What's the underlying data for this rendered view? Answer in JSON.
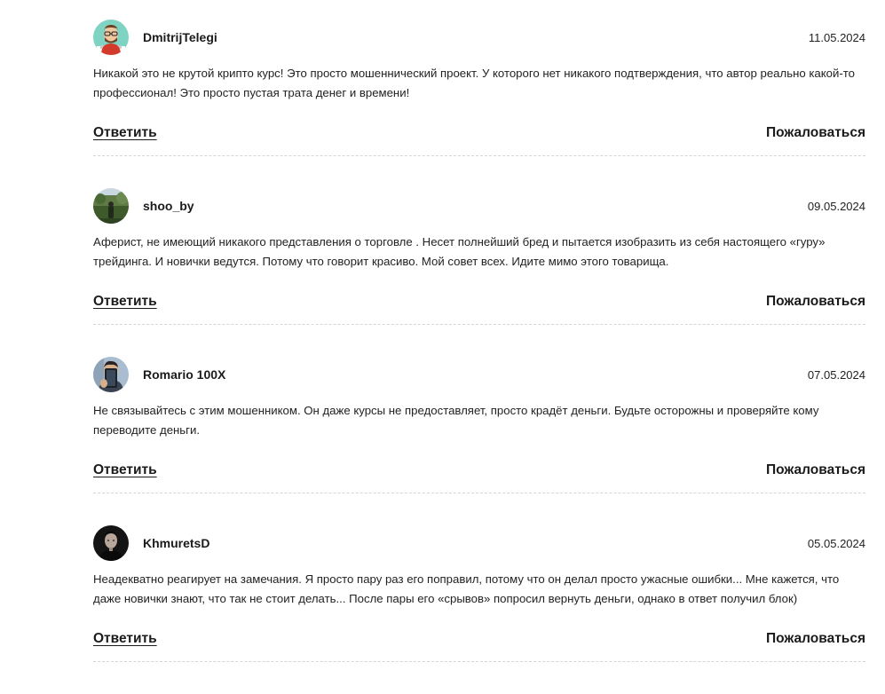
{
  "comments": [
    {
      "username": "DmitrijTelegi",
      "date": "11.05.2024",
      "text": "Никакой это не крутой крипто курс! Это просто мошеннический проект. У которого нет никакого подтверждения, что автор реально какой-то профессионал! Это просто пустая трата денег и времени!",
      "avatar_icon": "cartoon-avatar"
    },
    {
      "username": "shoo_by",
      "date": "09.05.2024",
      "text": "Аферист, не имеющий никакого представления о торговле . Несет полнейший бред и пытается изобразить из себя настоящего «гуру» трейдинга. И новички ведутся. Потому что говорит красиво. Мой совет всех. Идите мимо этого товарища.",
      "avatar_icon": "landscape-avatar"
    },
    {
      "username": "Romario 100X",
      "date": "07.05.2024",
      "text": "Не связывайтесь с этим мошенником. Он даже курсы не предоставляет, просто крадёт деньги. Будьте осторожны и проверяйте кому переводите деньги.",
      "avatar_icon": "selfie-avatar"
    },
    {
      "username": "KhmuretsD",
      "date": "05.05.2024",
      "text": "Неадекватно реагирует на замечания. Я просто пару раз его поправил, потому что он делал просто ужасные ошибки... Мне кажется, что даже новички знают, что так не стоит делать... После пары его «срывов» попросил вернуть деньги, однако в ответ получил блок)",
      "avatar_icon": "portrait-avatar"
    }
  ],
  "actions": {
    "reply_label": "Ответить",
    "report_label": "Пожаловаться"
  }
}
